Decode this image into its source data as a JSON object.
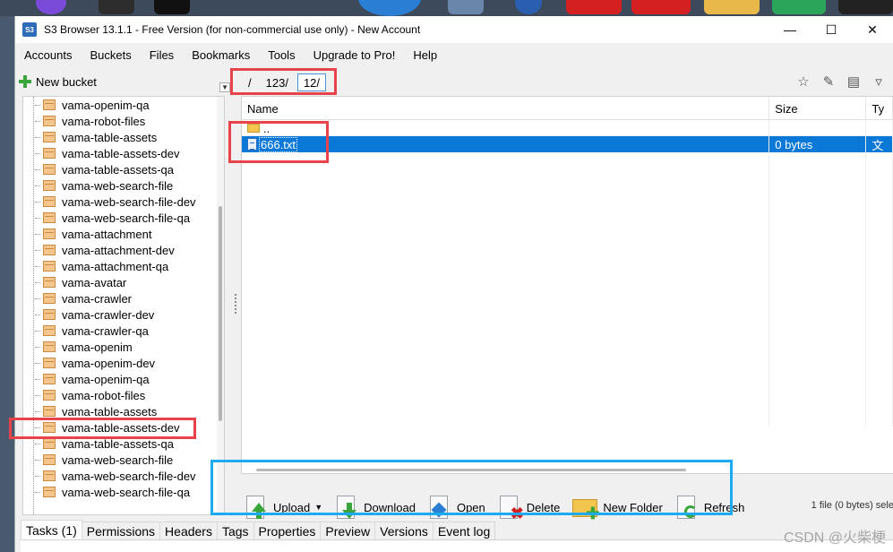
{
  "window": {
    "title": "S3 Browser 13.1.1 - Free Version (for non-commercial use only) - New Account",
    "app_icon_text": "S3"
  },
  "menu": [
    "Accounts",
    "Buckets",
    "Files",
    "Bookmarks",
    "Tools",
    "Upgrade to Pro!",
    "Help"
  ],
  "left": {
    "new_bucket_label": "New bucket",
    "buckets": [
      "vama-openim-qa",
      "vama-robot-files",
      "vama-table-assets",
      "vama-table-assets-dev",
      "vama-table-assets-qa",
      "vama-web-search-file",
      "vama-web-search-file-dev",
      "vama-web-search-file-qa",
      "vama-attachment",
      "vama-attachment-dev",
      "vama-attachment-qa",
      "vama-avatar",
      "vama-crawler",
      "vama-crawler-dev",
      "vama-crawler-qa",
      "vama-openim",
      "vama-openim-dev",
      "vama-openim-qa",
      "vama-robot-files",
      "vama-table-assets",
      "vama-table-assets-dev",
      "vama-table-assets-qa",
      "vama-web-search-file",
      "vama-web-search-file-dev",
      "vama-web-search-file-qa"
    ],
    "selected_index": 20
  },
  "path": {
    "crumbs": [
      "/",
      "123/",
      "12/"
    ]
  },
  "filelist": {
    "columns": [
      "Name",
      "Size",
      "Ty"
    ],
    "parent_label": "..",
    "files": [
      {
        "name": "666.txt",
        "size": "0 bytes",
        "type": "文"
      }
    ],
    "status": "1 file (0 bytes) sele"
  },
  "actions": {
    "upload": "Upload",
    "download": "Download",
    "open": "Open",
    "delete": "Delete",
    "new_folder": "New Folder",
    "refresh": "Refresh"
  },
  "tabs": [
    "Tasks (1)",
    "Permissions",
    "Headers",
    "Tags",
    "Properties",
    "Preview",
    "Versions",
    "Event log"
  ],
  "watermark": "CSDN @火柴梗",
  "colors": {
    "selection": "#0a78d7",
    "highlight_red": "#e8424a",
    "highlight_blue": "#1eaaf0"
  }
}
